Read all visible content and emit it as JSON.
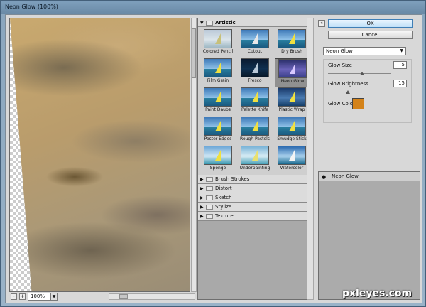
{
  "window": {
    "title": "Neon Glow (100%)"
  },
  "preview": {
    "zoom": "100%",
    "zoom_in": "+",
    "zoom_out": "-"
  },
  "gallery": {
    "open_category": "Artistic",
    "filters": [
      {
        "label": "Colored Pencil"
      },
      {
        "label": "Cutout"
      },
      {
        "label": "Dry Brush"
      },
      {
        "label": "Film Grain"
      },
      {
        "label": "Fresco"
      },
      {
        "label": "Neon Glow",
        "selected": true
      },
      {
        "label": "Paint Daubs"
      },
      {
        "label": "Palette Knife"
      },
      {
        "label": "Plastic Wrap"
      },
      {
        "label": "Poster Edges"
      },
      {
        "label": "Rough Pastels"
      },
      {
        "label": "Smudge Stick"
      },
      {
        "label": "Sponge"
      },
      {
        "label": "Underpainting"
      },
      {
        "label": "Watercolor"
      }
    ],
    "categories": [
      "Brush Strokes",
      "Distort",
      "Sketch",
      "Stylize",
      "Texture"
    ]
  },
  "buttons": {
    "ok": "OK",
    "cancel": "Cancel",
    "collapse": "«"
  },
  "filter_select": {
    "value": "Neon Glow"
  },
  "params": {
    "glow_size": {
      "label": "Glow Size",
      "value": "5",
      "slider": 0.55
    },
    "glow_brightness": {
      "label": "Glow Brightness",
      "value": "15",
      "slider": 0.25
    },
    "glow_color": {
      "label": "Glow Color",
      "color": "#d4831a"
    }
  },
  "layers": [
    {
      "label": "Neon Glow"
    }
  ],
  "watermark": "pxleyes.com"
}
